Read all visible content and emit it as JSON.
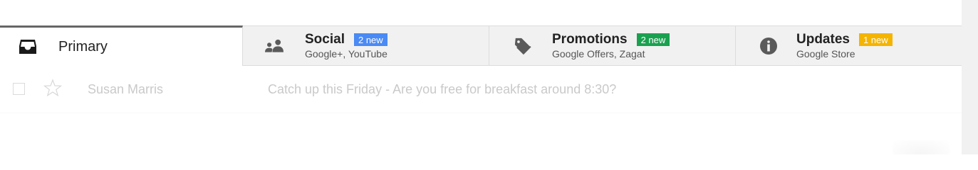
{
  "tabs": [
    {
      "label": "Primary",
      "icon": "inbox-icon",
      "active": true
    },
    {
      "label": "Social",
      "badge": "2 new",
      "badge_color": "#4a8af4",
      "subtitle": "Google+, YouTube",
      "icon": "people-icon"
    },
    {
      "label": "Promotions",
      "badge": "2 new",
      "badge_color": "#1aa150",
      "subtitle": "Google Offers, Zagat",
      "icon": "tag-icon"
    },
    {
      "label": "Updates",
      "badge": "1 new",
      "badge_color": "#f4b400",
      "subtitle": "Google Store",
      "icon": "info-icon"
    }
  ],
  "email_row": {
    "sender": "Susan Marris",
    "subject": "Catch up this Friday - Are you free for breakfast around 8:30?"
  },
  "colors": {
    "tab_bar_bg": "#f1f1f1",
    "active_tab_border": "#666666"
  }
}
